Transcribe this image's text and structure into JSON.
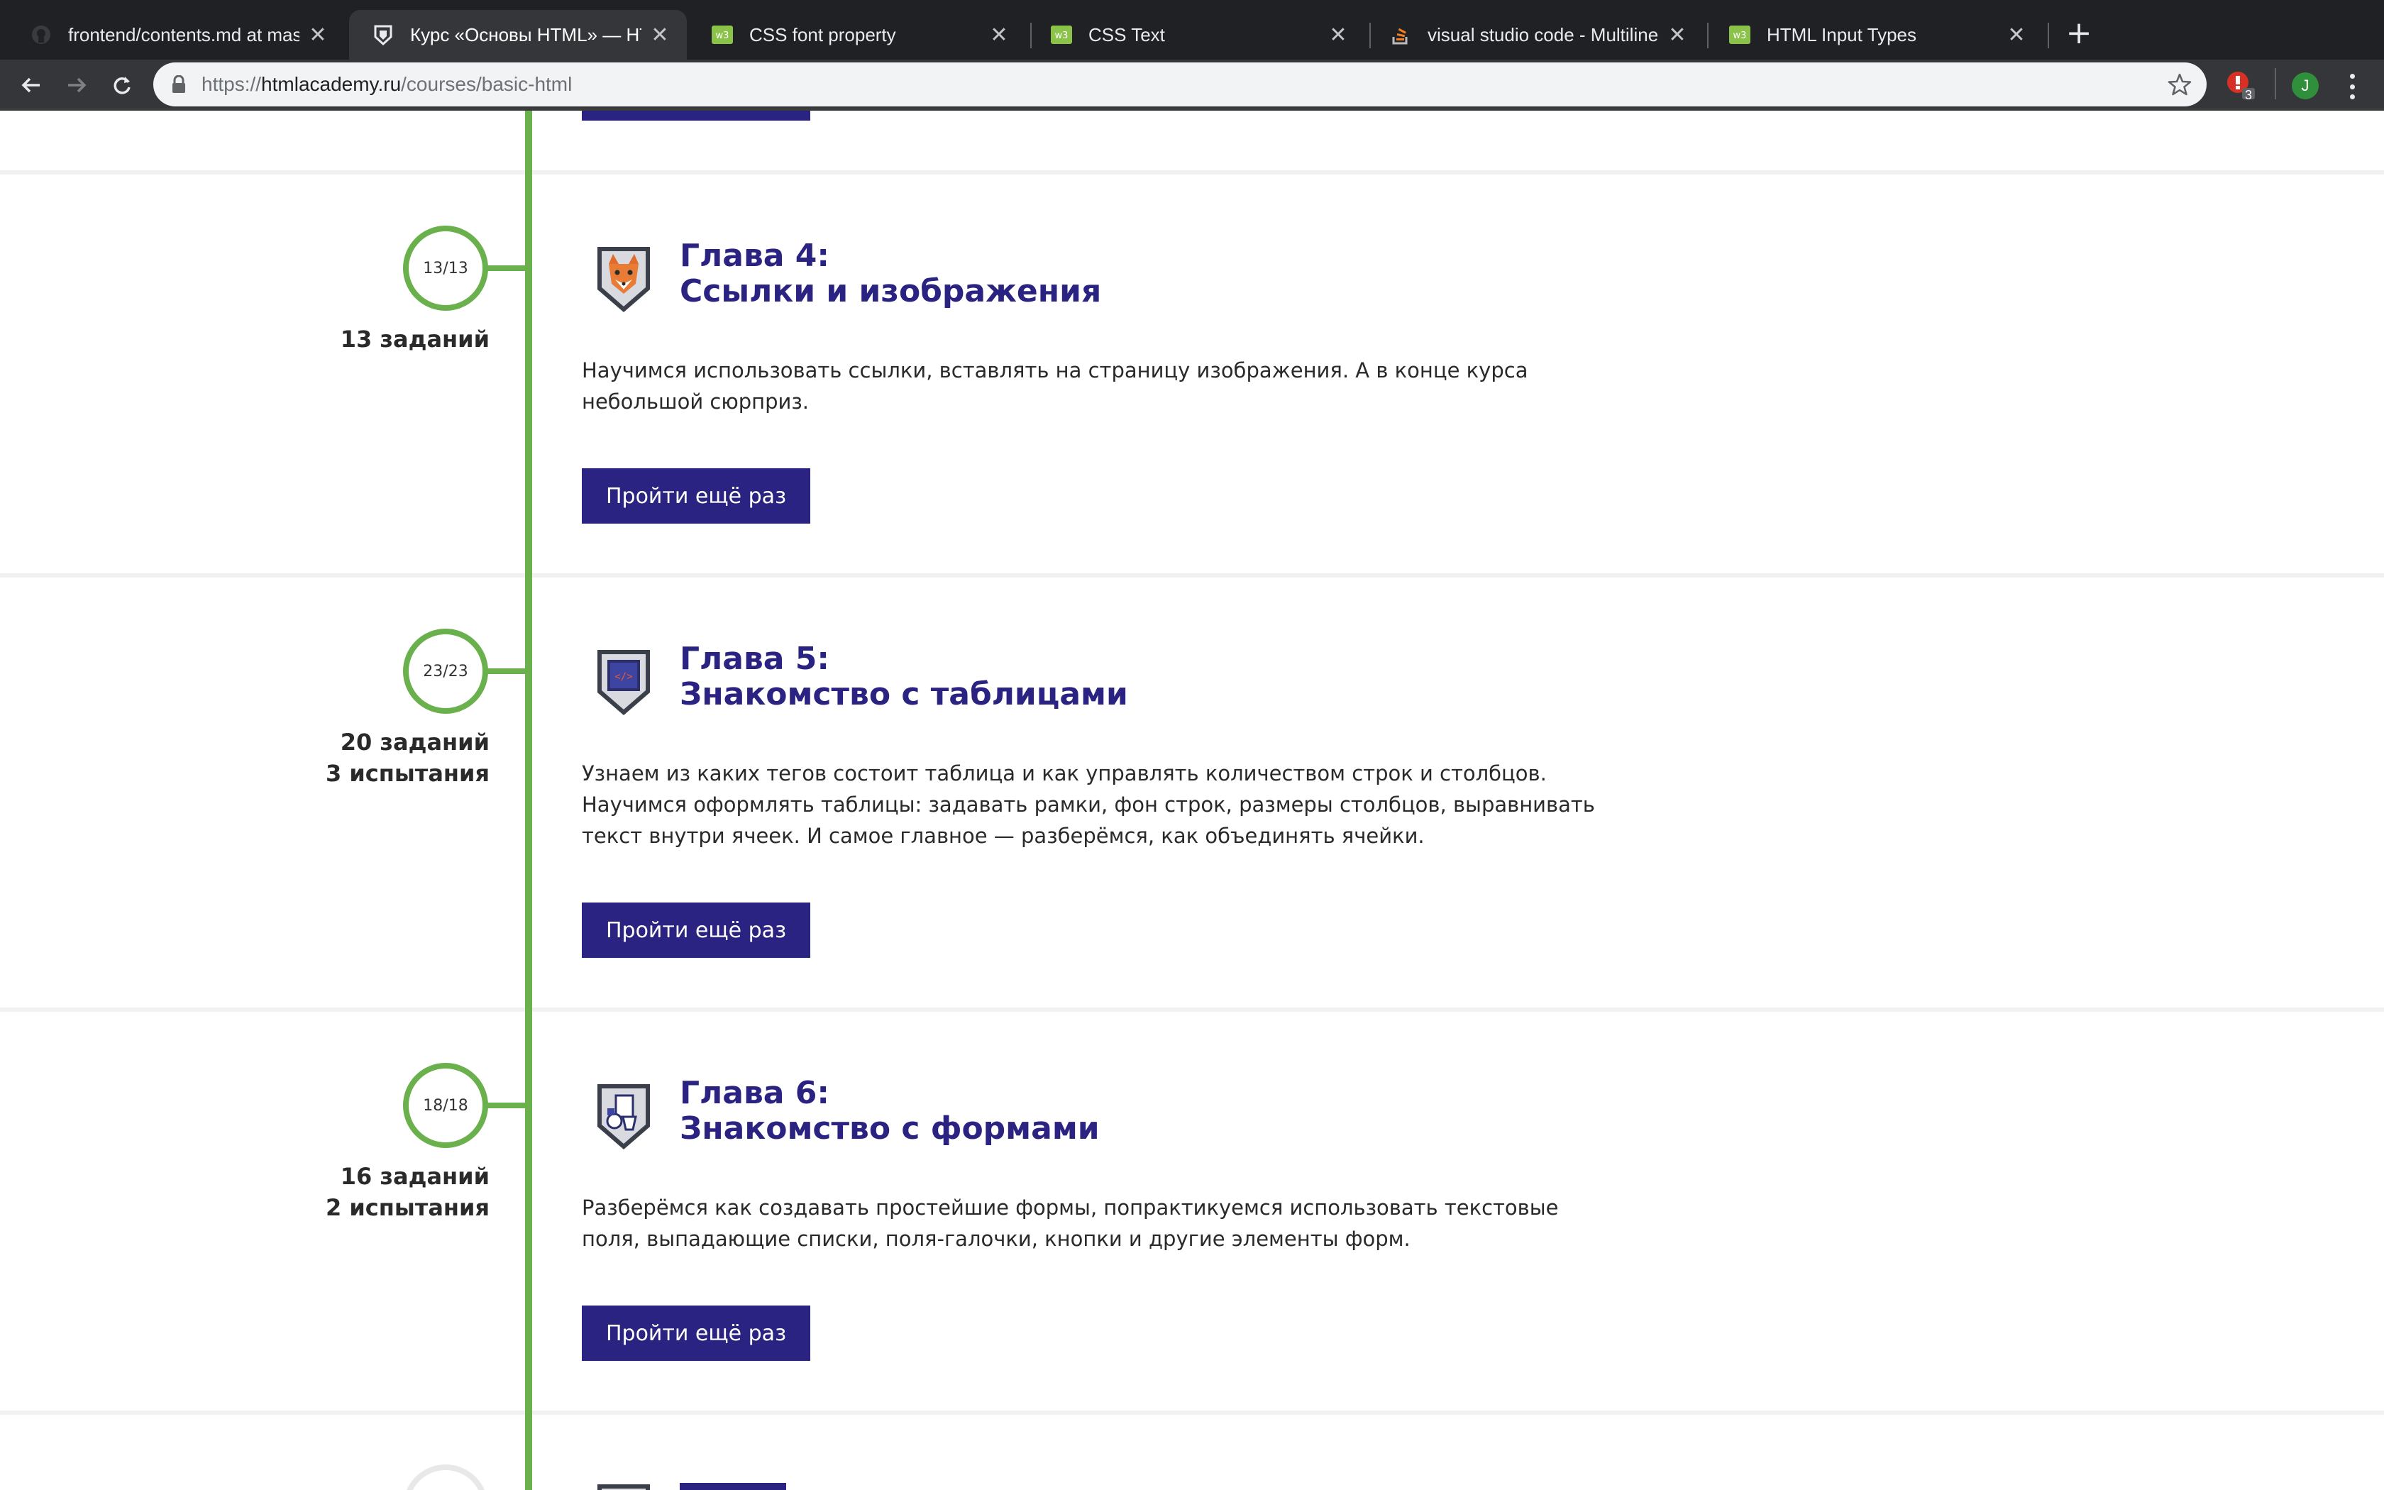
{
  "browser": {
    "tabs": [
      {
        "title": "frontend/contents.md at maste",
        "icon": "github-icon",
        "active": false
      },
      {
        "title": "Курс «Основы HTML» — HTM",
        "icon": "htmlacademy-shield-icon",
        "active": true
      },
      {
        "title": "CSS font property",
        "icon": "w3schools-icon",
        "active": false
      },
      {
        "title": "CSS Text",
        "icon": "w3schools-icon",
        "active": false
      },
      {
        "title": "visual studio code - Multiline e",
        "icon": "stackoverflow-icon",
        "active": false
      },
      {
        "title": "HTML Input Types",
        "icon": "w3schools-icon",
        "active": false
      }
    ],
    "url_scheme": "https://",
    "url_host": "htmlacademy.ru",
    "url_path": "/courses/basic-html",
    "extension_badge": "3",
    "profile_initial": "J"
  },
  "timeline": {
    "accent_color": "#6ab04c",
    "brand_color": "#2b2381"
  },
  "chapters": [
    {
      "progress": "13/13",
      "stats": [
        "13 заданий"
      ],
      "title_line1": "Глава 4:",
      "title_line2": "Ссылки и изображения",
      "badge_icon": "fox-shield-icon",
      "description": [
        "Научимся использовать ссылки, вставлять на страницу изображения. А в конце курса",
        "небольшой сюрприз."
      ],
      "button_label": "Пройти ещё раз"
    },
    {
      "progress": "23/23",
      "stats": [
        "20 заданий",
        "3 испытания"
      ],
      "title_line1": "Глава 5:",
      "title_line2": "Знакомство с таблицами",
      "badge_icon": "code-table-shield-icon",
      "description": [
        "Узнаем из каких тегов состоит таблица и как управлять количеством строк и столбцов.",
        "Научимся оформлять таблицы: задавать рамки, фон строк, размеры столбцов, выравнивать",
        "текст внутри ячеек. И самое главное — разберёмся, как объединять ячейки."
      ],
      "button_label": "Пройти ещё раз"
    },
    {
      "progress": "18/18",
      "stats": [
        "16 заданий",
        "2 испытания"
      ],
      "title_line1": "Глава 6:",
      "title_line2": "Знакомство с формами",
      "badge_icon": "forms-shield-icon",
      "description": [
        "Разберёмся как создавать простейшие формы, попрактикуемся использовать текстовые",
        "поля, выпадающие списки, поля-галочки, кнопки и другие элементы форм."
      ],
      "button_label": "Пройти ещё раз"
    }
  ]
}
